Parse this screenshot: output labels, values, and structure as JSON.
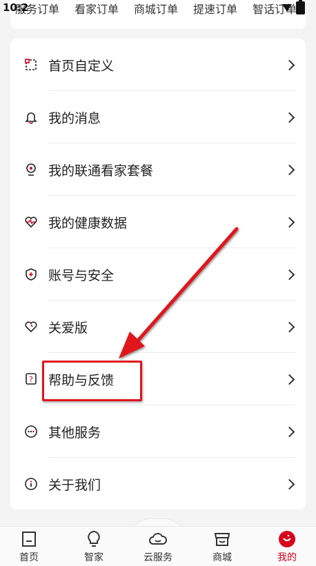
{
  "status": {
    "time": "10:2"
  },
  "orders_strip": [
    "服务订单",
    "看家订单",
    "商城订单",
    "提速订单",
    "智话订单"
  ],
  "menu": [
    {
      "label": "首页自定义",
      "icon": "customize-icon"
    },
    {
      "label": "我的消息",
      "icon": "bell-icon"
    },
    {
      "label": "我的联通看家套餐",
      "icon": "camera-icon"
    },
    {
      "label": "我的健康数据",
      "icon": "heart-pulse-icon"
    },
    {
      "label": "账号与安全",
      "icon": "shield-icon"
    },
    {
      "label": "关爱版",
      "icon": "heart-icon"
    },
    {
      "label": "帮助与反馈",
      "icon": "help-icon"
    },
    {
      "label": "其他服务",
      "icon": "more-icon"
    },
    {
      "label": "关于我们",
      "icon": "info-icon"
    }
  ],
  "tabs": [
    {
      "label": "首页",
      "icon": "home-icon"
    },
    {
      "label": "智家",
      "icon": "bulb-icon"
    },
    {
      "label": "云服务",
      "icon": "cloud-icon"
    },
    {
      "label": "商城",
      "icon": "store-icon"
    },
    {
      "label": "我的",
      "icon": "profile-icon",
      "active": true
    }
  ],
  "colors": {
    "accent": "#d6001c",
    "highlight": "#e0141e"
  }
}
